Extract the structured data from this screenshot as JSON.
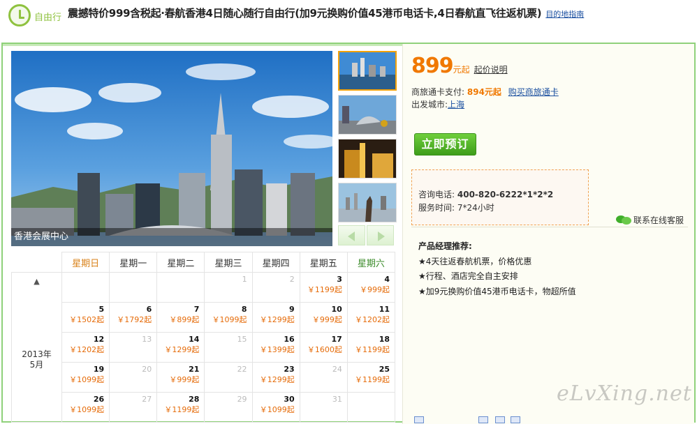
{
  "header": {
    "badge_label": "自由行",
    "title": "震撼特价999含税起·春航香港4日随心随行自由行(加9元换购价值45港币电话卡,4日春航直飞往返机票)",
    "guide_link": "目的地指南"
  },
  "gallery": {
    "caption": "香港会展中心",
    "thumbnails": [
      "harbour-skyline",
      "golden-bauhinia-square",
      "night-statue",
      "avenue-of-stars-statue"
    ]
  },
  "calendar": {
    "year_month": [
      "2013年",
      "5月"
    ],
    "up_arrow": "▲",
    "weekdays": [
      "星期日",
      "星期一",
      "星期二",
      "星期三",
      "星期四",
      "星期五",
      "星期六"
    ],
    "weeks": [
      [
        {
          "day": ""
        },
        {
          "day": ""
        },
        {
          "day": ""
        },
        {
          "day": "1",
          "off": true
        },
        {
          "day": "2",
          "off": true
        },
        {
          "day": "3",
          "price": "￥1199起"
        },
        {
          "day": "4",
          "price": "￥999起"
        }
      ],
      [
        {
          "day": "5",
          "price": "￥1502起"
        },
        {
          "day": "6",
          "price": "￥1792起"
        },
        {
          "day": "7",
          "price": "￥899起"
        },
        {
          "day": "8",
          "price": "￥1099起"
        },
        {
          "day": "9",
          "price": "￥1299起"
        },
        {
          "day": "10",
          "price": "￥999起"
        },
        {
          "day": "11",
          "price": "￥1202起"
        }
      ],
      [
        {
          "day": "12",
          "price": "￥1202起"
        },
        {
          "day": "13",
          "off": true
        },
        {
          "day": "14",
          "price": "￥1299起"
        },
        {
          "day": "15",
          "off": true
        },
        {
          "day": "16",
          "price": "￥1399起"
        },
        {
          "day": "17",
          "price": "￥1600起"
        },
        {
          "day": "18",
          "price": "￥1199起"
        }
      ],
      [
        {
          "day": "19",
          "price": "￥1099起"
        },
        {
          "day": "20",
          "off": true
        },
        {
          "day": "21",
          "price": "￥999起"
        },
        {
          "day": "22",
          "off": true
        },
        {
          "day": "23",
          "price": "￥1299起"
        },
        {
          "day": "24",
          "off": true
        },
        {
          "day": "25",
          "price": "￥1199起"
        }
      ],
      [
        {
          "day": "26",
          "price": "￥1099起"
        },
        {
          "day": "27",
          "off": true
        },
        {
          "day": "28",
          "price": "￥1199起"
        },
        {
          "day": "29",
          "off": true
        },
        {
          "day": "30",
          "price": "￥1099起"
        },
        {
          "day": "31",
          "off": true
        },
        {
          "day": ""
        }
      ]
    ]
  },
  "price": {
    "amount": "899",
    "unit": "元起",
    "note": "起价说明"
  },
  "card": {
    "label": "商旅通卡支付:",
    "price": "894元起",
    "buy_link": "购买商旅通卡"
  },
  "city": {
    "label": "出发城市:",
    "value": "上海"
  },
  "book_button": "立即预订",
  "consult": {
    "phone_label": "咨询电话:",
    "phone": "400-820-6222*1*2*2",
    "hours_label": "服务时间:",
    "hours": "7*24小时"
  },
  "chat_link": "联系在线客服",
  "recommend": {
    "heading": "产品经理推荐:",
    "items": [
      "★4天往返春航机票，价格优惠",
      "★行程、酒店完全自主安排",
      "★加9元换购价值45港币电话卡，物超所值"
    ]
  },
  "watermark": "eLvXing.net",
  "colors": {
    "accent_green": "#8fc23f",
    "price_orange": "#f07800",
    "link_blue": "#1a4fa0"
  }
}
